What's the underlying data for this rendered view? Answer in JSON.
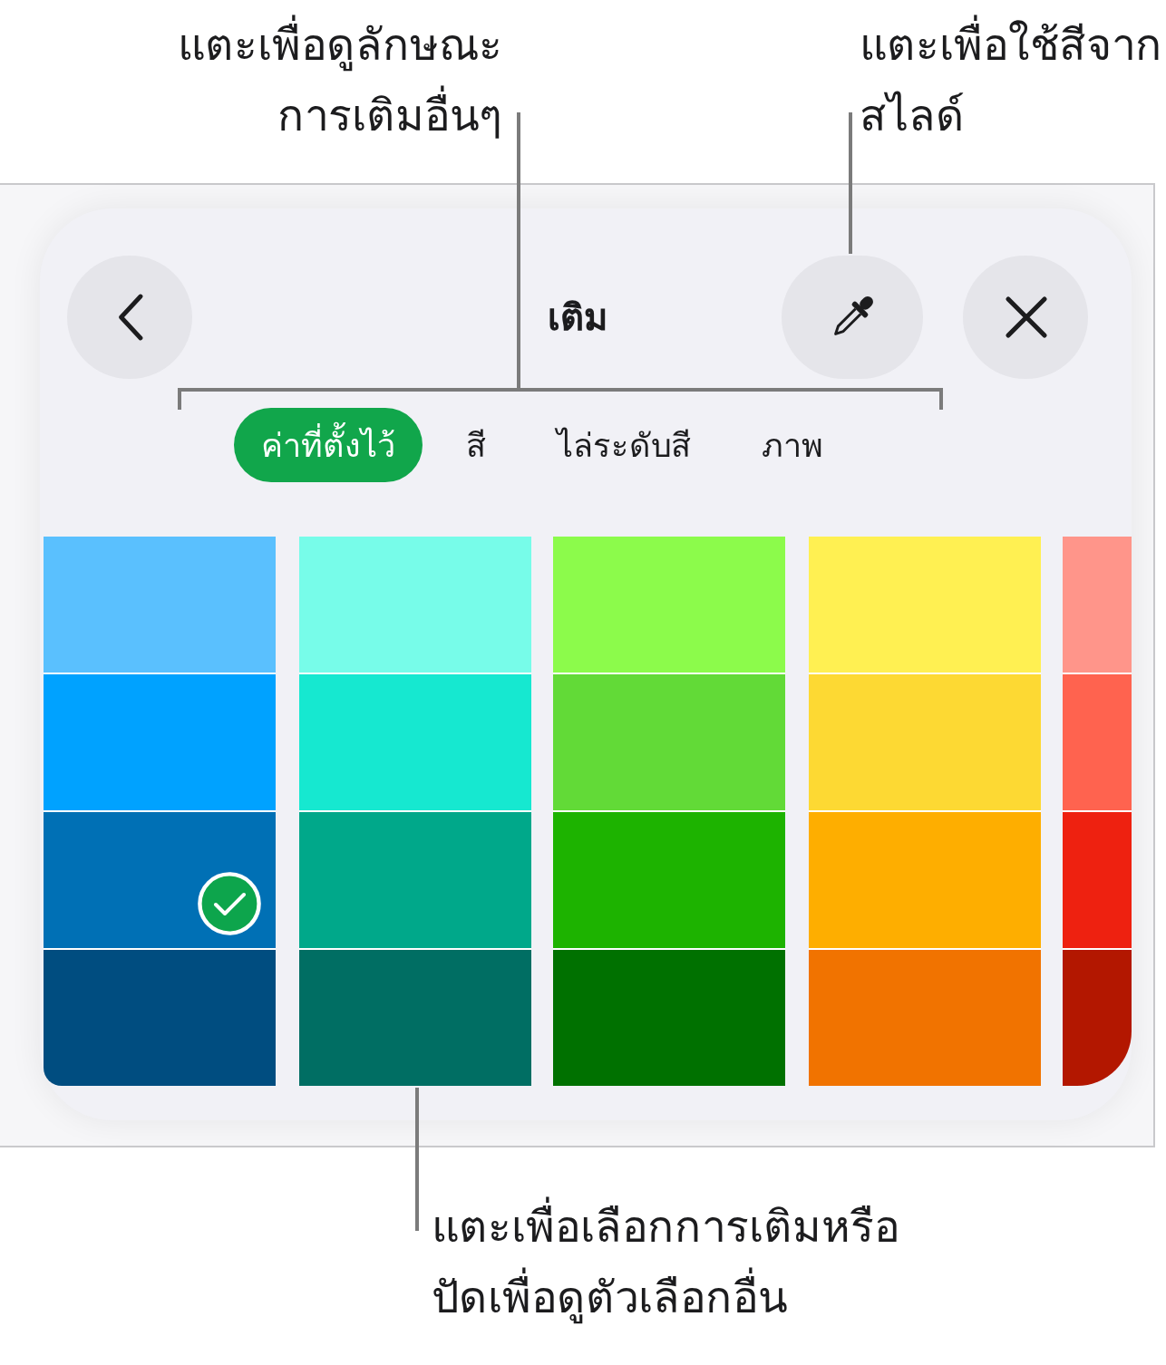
{
  "top_callouts": [
    {
      "lines": [
        "แตะเพื่อดูลักษณะ",
        "การเติมอื่นๆ"
      ]
    },
    {
      "lines": [
        "แตะเพื่อใช้สีจาก",
        "สไลด์"
      ]
    }
  ],
  "panel": {
    "title": "เติม",
    "tabs": [
      {
        "label": "ค่าที่ตั้งไว้",
        "selected": true
      },
      {
        "label": "สี",
        "selected": false
      },
      {
        "label": "ไล่ระดับสี",
        "selected": false
      },
      {
        "label": "ภาพ",
        "selected": false
      }
    ],
    "swatch_columns": [
      {
        "swatches": [
          {
            "color": "#5ac0fe",
            "selected": false
          },
          {
            "color": "#00a2ff",
            "selected": false
          },
          {
            "color": "#0070b5",
            "selected": true
          },
          {
            "color": "#004d80",
            "selected": false
          }
        ]
      },
      {
        "swatches": [
          {
            "color": "#77fce9",
            "selected": false
          },
          {
            "color": "#16e8d0",
            "selected": false
          },
          {
            "color": "#00a88a",
            "selected": false
          },
          {
            "color": "#006e63",
            "selected": false
          }
        ]
      },
      {
        "swatches": [
          {
            "color": "#8cfb4b",
            "selected": false
          },
          {
            "color": "#62da37",
            "selected": false
          },
          {
            "color": "#1db300",
            "selected": false
          },
          {
            "color": "#007100",
            "selected": false
          }
        ]
      },
      {
        "swatches": [
          {
            "color": "#fff052",
            "selected": false
          },
          {
            "color": "#fdd933",
            "selected": false
          },
          {
            "color": "#feae00",
            "selected": false
          },
          {
            "color": "#f17300",
            "selected": false
          }
        ]
      },
      {
        "swatches": [
          {
            "color": "#ff958a",
            "selected": false
          },
          {
            "color": "#ff634f",
            "selected": false
          },
          {
            "color": "#ee2110",
            "selected": false
          },
          {
            "color": "#b31700",
            "selected": false
          }
        ]
      }
    ]
  },
  "bottom_callout": {
    "lines": [
      "แตะเพื่อเลือกการเติมหรือ",
      "ปัดเพื่อดูตัวเลือกอื่น"
    ]
  }
}
